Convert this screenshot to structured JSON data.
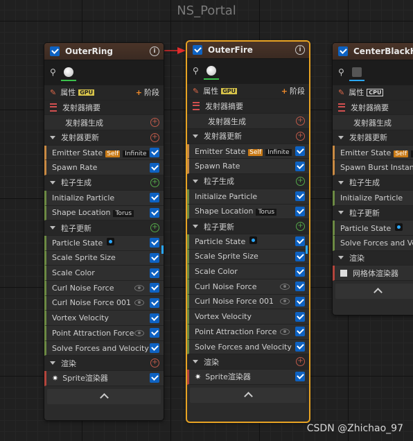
{
  "graph_title": "NS_Portal",
  "watermark": "CSDN @Zhichao_97",
  "labels": {
    "attributes": "属性",
    "gpu": "GPU",
    "cpu": "CPU",
    "stage": "阶段",
    "emitter_summary": "发射器摘要",
    "emitter_spawn": "发射器生成",
    "emitter_update": "发射器更新",
    "particle_spawn": "粒子生成",
    "particle_update": "粒子更新",
    "render": "渲染",
    "sprite_renderer": "Sprite渲染器",
    "mesh_renderer": "网格体渲染器",
    "self_tag": "Self",
    "infinite_tag": "Infinite",
    "torus_tag": "Torus"
  },
  "nodes": [
    {
      "name": "OuterRing",
      "sim": "GPU",
      "modules": {
        "emitter_state": "Emitter State",
        "spawn_rate": "Spawn Rate",
        "initialize_particle": "Initialize Particle",
        "shape_location": "Shape Location",
        "particle_state": "Particle State",
        "scale_sprite_size": "Scale Sprite Size",
        "scale_color": "Scale Color",
        "curl_noise_force": "Curl Noise Force",
        "curl_noise_force_001": "Curl Noise Force 001",
        "vortex_velocity": "Vortex Velocity",
        "point_attraction_force": "Point Attraction Force",
        "solve_forces": "Solve Forces and Velocity"
      }
    },
    {
      "name": "OuterFire",
      "sim": "GPU",
      "modules": {
        "emitter_state": "Emitter State",
        "spawn_rate": "Spawn Rate",
        "initialize_particle": "Initialize Particle",
        "shape_location": "Shape Location",
        "particle_state": "Particle State",
        "scale_sprite_size": "Scale Sprite Size",
        "scale_color": "Scale Color",
        "curl_noise_force": "Curl Noise Force",
        "curl_noise_force_001": "Curl Noise Force 001",
        "vortex_velocity": "Vortex Velocity",
        "point_attraction_force": "Point Attraction Force",
        "solve_forces": "Solve Forces and Velocity"
      }
    },
    {
      "name": "CenterBlackHo",
      "sim": "CPU",
      "modules": {
        "emitter_state": "Emitter State",
        "spawn_burst": "Spawn Burst Instanta",
        "initialize_particle": "Initialize Particle",
        "particle_state": "Particle State",
        "solve_forces": "Solve Forces and Velo"
      }
    }
  ],
  "colors": {
    "selection": "#e8a323",
    "checkbox": "#0e62c2",
    "arrow": "#e02b2b"
  }
}
